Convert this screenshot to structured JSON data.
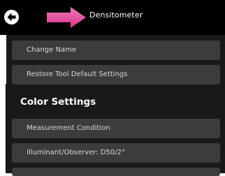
{
  "header": {
    "title": "Densitometer",
    "back_icon": "back-arrow-icon",
    "accent_icon": "pink-arrow-icon",
    "accent_color": "#e3358f"
  },
  "menu": {
    "items_top": [
      {
        "label": "Change Name"
      },
      {
        "label": "Restore Tool Default Settings"
      }
    ],
    "section_heading": "Color Settings",
    "items_color": [
      {
        "label": "Measurement Condition"
      },
      {
        "label": "Illuminant/Observer: D50/2°"
      }
    ]
  }
}
